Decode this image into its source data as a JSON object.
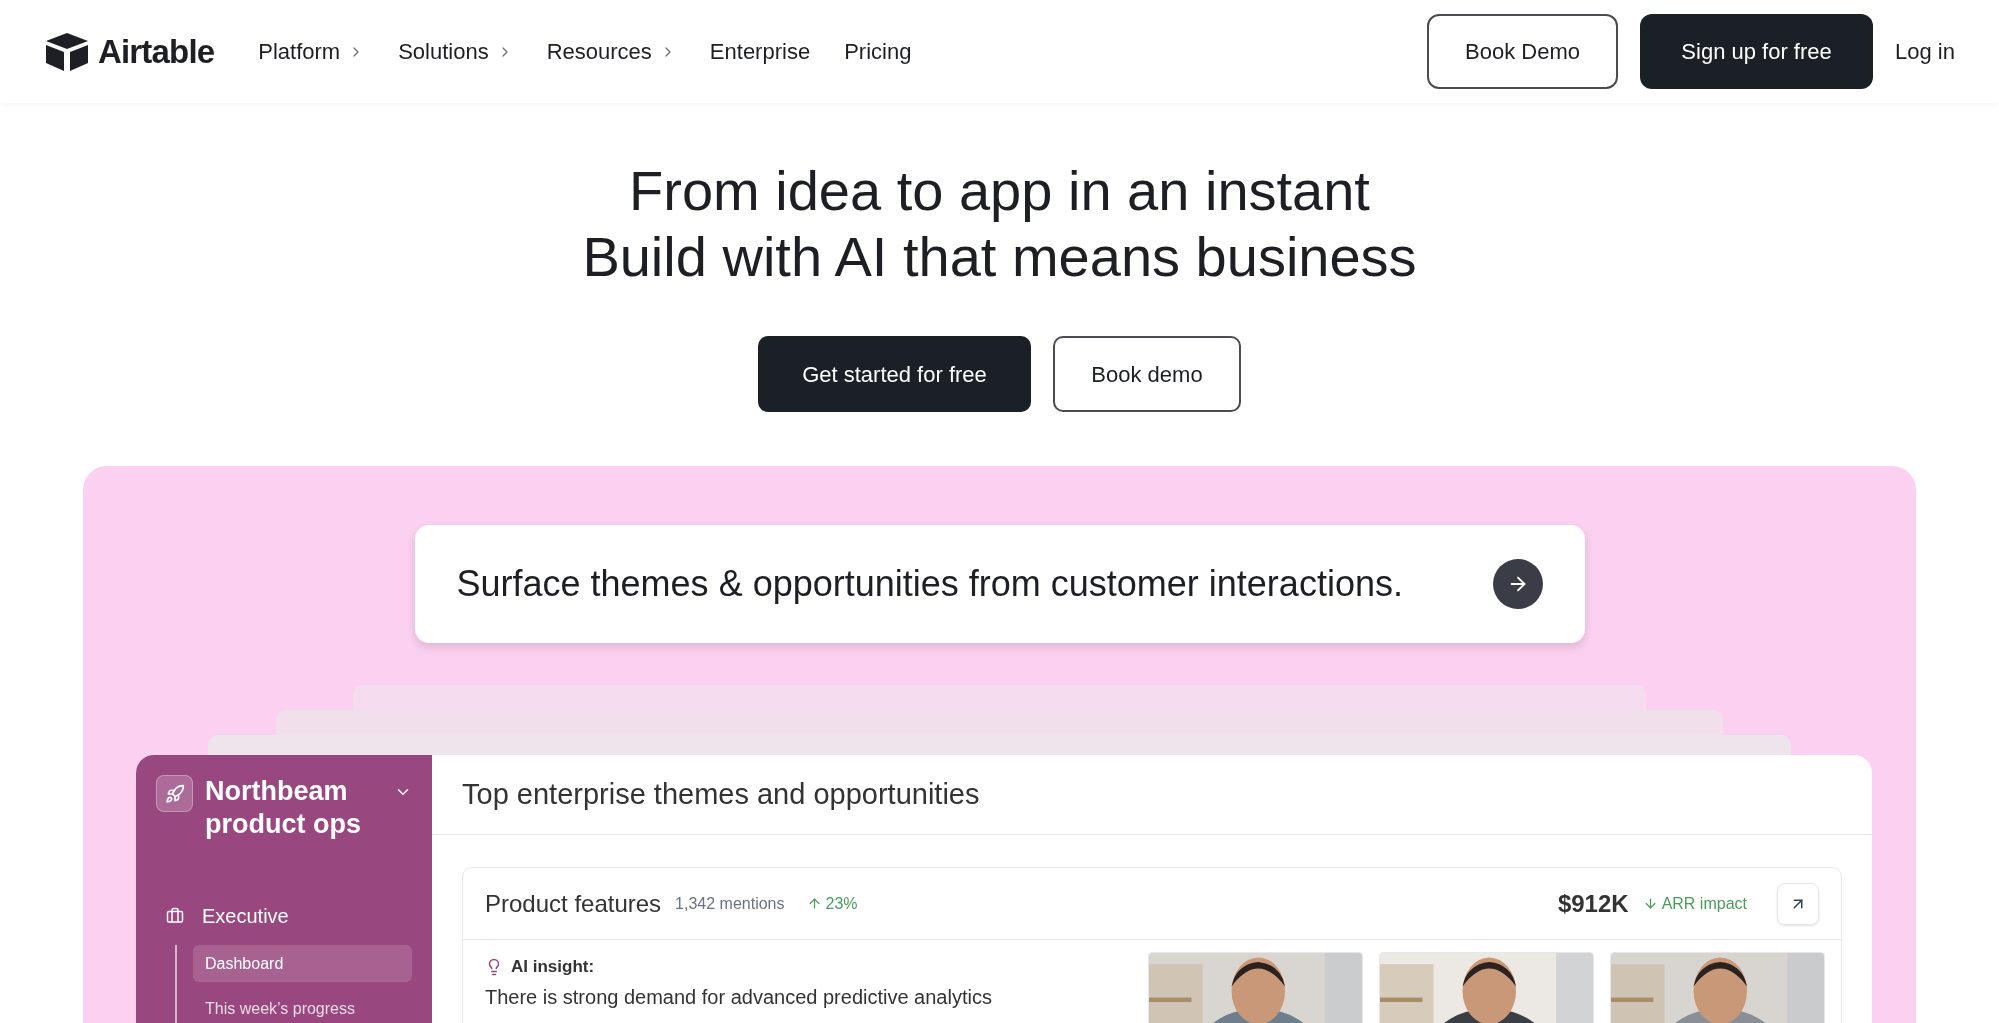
{
  "header": {
    "logo": "Airtable",
    "nav": [
      {
        "label": "Platform",
        "has_submenu": true
      },
      {
        "label": "Solutions",
        "has_submenu": true
      },
      {
        "label": "Resources",
        "has_submenu": true
      },
      {
        "label": "Enterprise",
        "has_submenu": false
      },
      {
        "label": "Pricing",
        "has_submenu": false
      }
    ],
    "book_demo": "Book Demo",
    "sign_up": "Sign up for free",
    "log_in": "Log in"
  },
  "hero": {
    "headline": [
      "From idea to app in an instant",
      "Build with AI that means business"
    ],
    "primary_button": "Get started for free",
    "secondary_button": "Book demo"
  },
  "prompt": {
    "text": "Surface themes & opportunities from customer interactions."
  },
  "app": {
    "workspace": "Northbeam product ops",
    "sidebar": [
      {
        "label": "Executive",
        "children": [
          {
            "label": "Dashboard",
            "selected": true
          },
          {
            "label": "This week’s progress",
            "selected": false
          }
        ]
      }
    ],
    "title": "Top enterprise themes and opportunities",
    "card": {
      "title": "Product features",
      "mentions": "1,342 mentions",
      "change": "23%",
      "value": "$912K",
      "impact": "ARR impact",
      "insight_label": "AI insight:",
      "insight": "There is strong demand for advanced predictive analytics"
    }
  }
}
